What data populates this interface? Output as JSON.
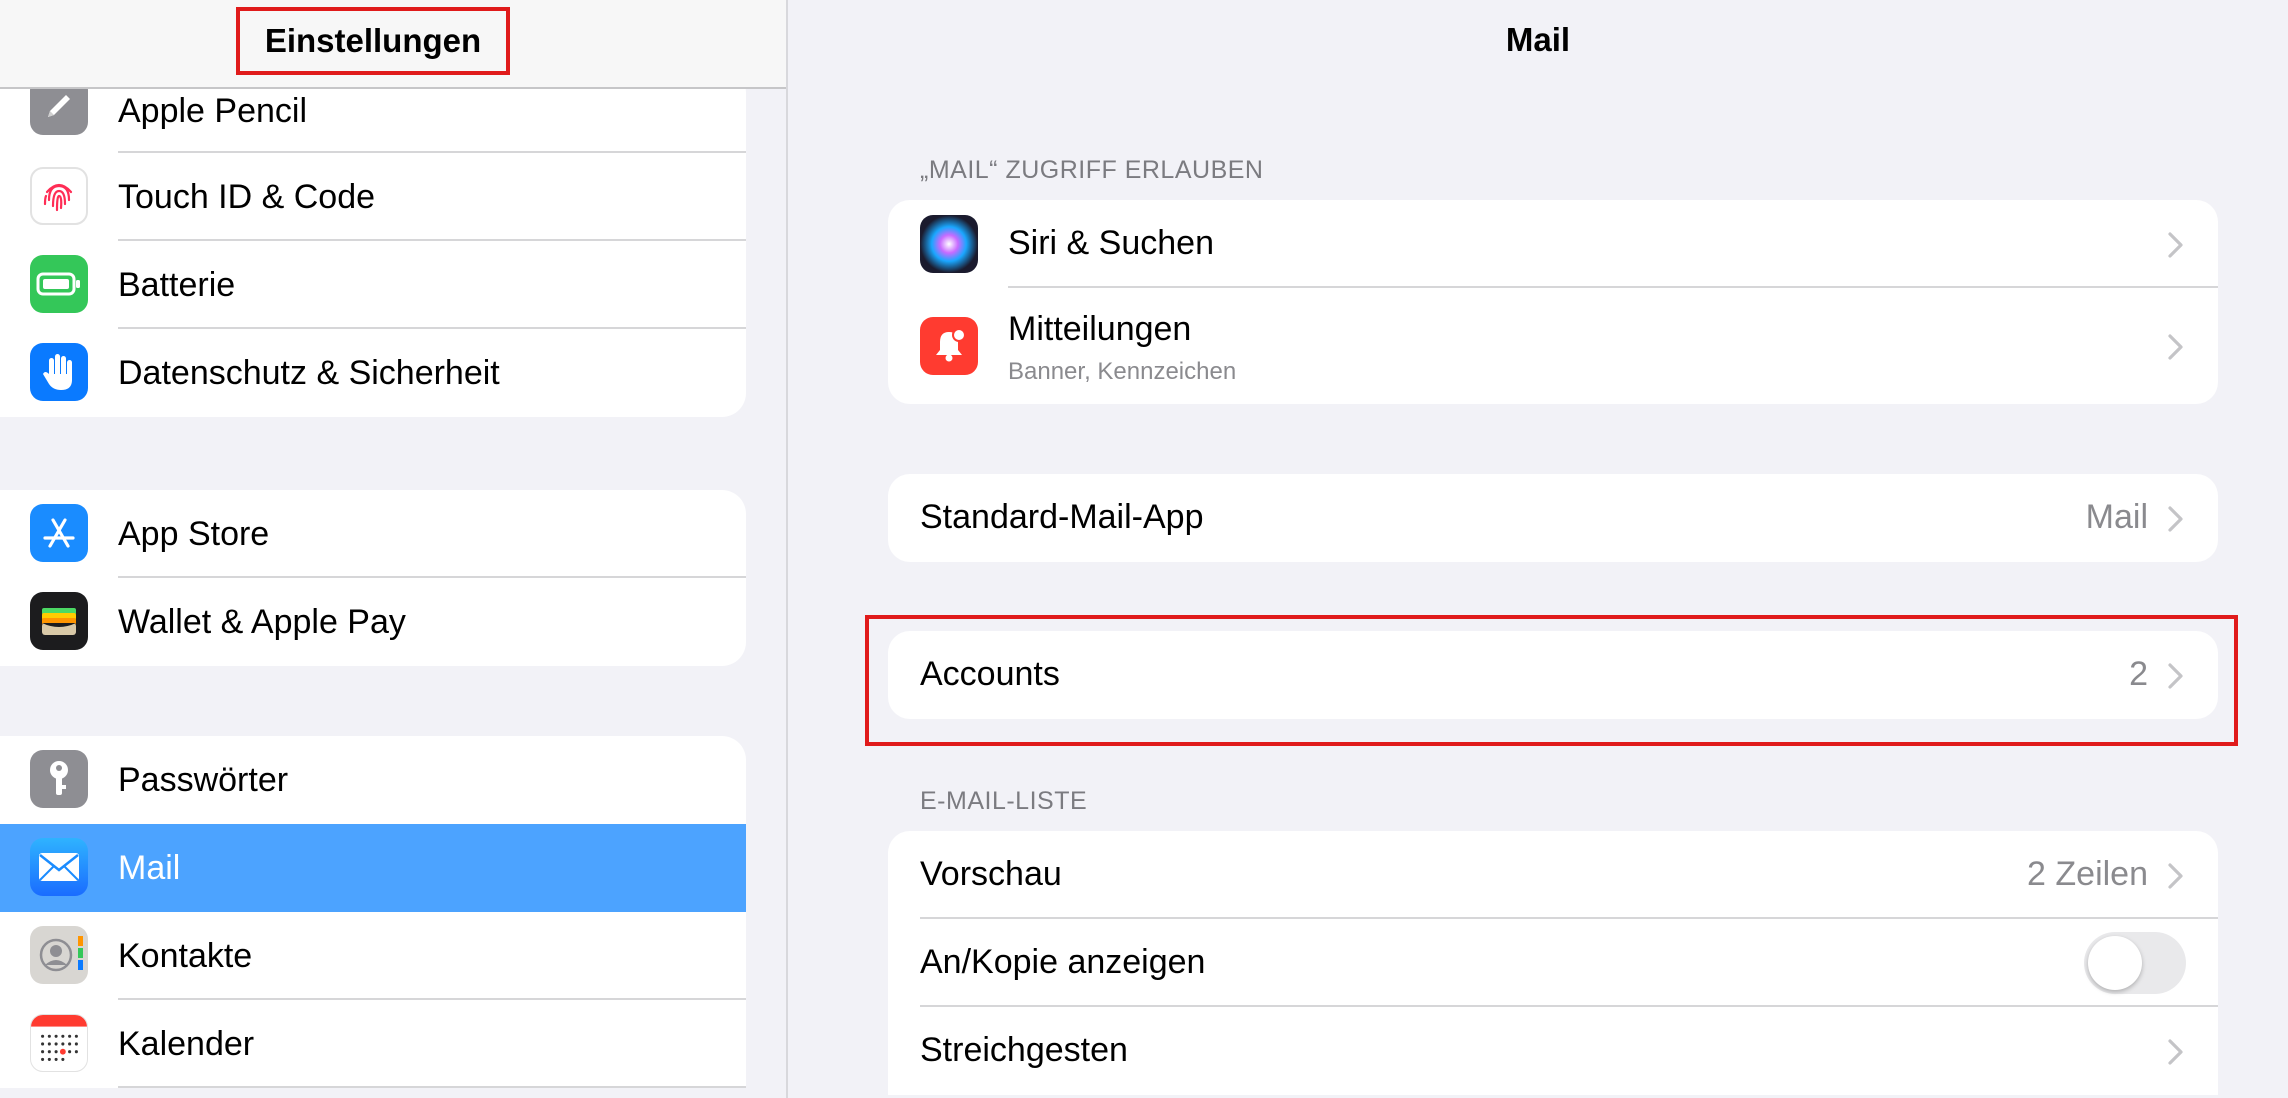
{
  "sidebar": {
    "title": "Einstellungen",
    "groups": [
      [
        {
          "label": "Apple Pencil",
          "icon": "pencil-icon"
        },
        {
          "label": "Touch ID & Code",
          "icon": "fingerprint-icon"
        },
        {
          "label": "Batterie",
          "icon": "battery-icon"
        },
        {
          "label": "Datenschutz & Sicherheit",
          "icon": "hand-icon"
        }
      ],
      [
        {
          "label": "App Store",
          "icon": "app-store-icon"
        },
        {
          "label": "Wallet & Apple Pay",
          "icon": "wallet-icon"
        }
      ],
      [
        {
          "label": "Passwörter",
          "icon": "key-icon"
        },
        {
          "label": "Mail",
          "icon": "mail-icon",
          "selected": true
        },
        {
          "label": "Kontakte",
          "icon": "contacts-icon"
        },
        {
          "label": "Kalender",
          "icon": "calendar-icon"
        }
      ]
    ]
  },
  "main": {
    "title": "Mail",
    "access_header": "„MAIL“ ZUGRIFF ERLAUBEN",
    "siri_label": "Siri & Suchen",
    "notifications_label": "Mitteilungen",
    "notifications_sub": "Banner, Kennzeichen",
    "default_app_label": "Standard-Mail-App",
    "default_app_value": "Mail",
    "accounts_label": "Accounts",
    "accounts_value": "2",
    "list_header": "E-MAIL-LISTE",
    "preview_label": "Vorschau",
    "preview_value": "2 Zeilen",
    "tocc_label": "An/Kopie anzeigen",
    "tocc_on": false,
    "swipe_label": "Streichgesten"
  },
  "colors": {
    "selection": "#4ca3ff",
    "highlight": "#e01b1b",
    "background": "#f2f2f7"
  }
}
